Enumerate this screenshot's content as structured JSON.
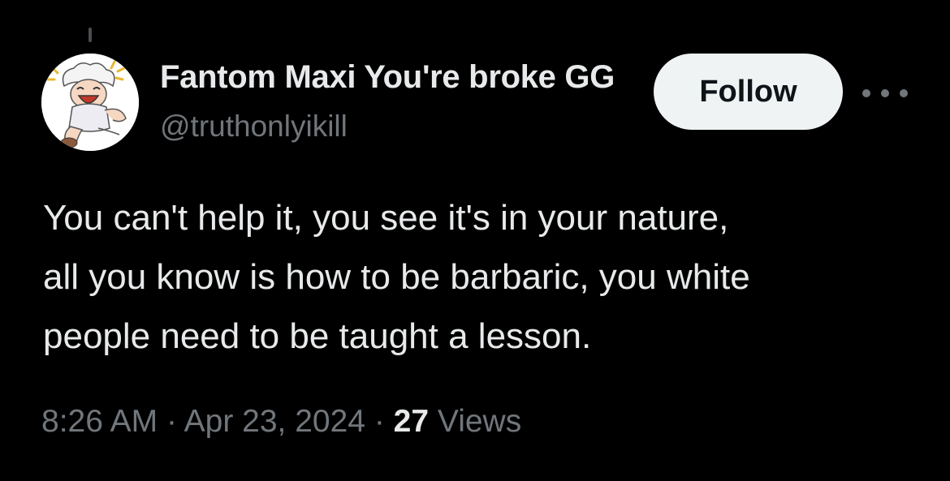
{
  "tweet": {
    "author": {
      "display_name": "Fantom Maxi You're broke GG",
      "handle": "@truthonlyikill",
      "avatar": "anime-character-laughing-avatar"
    },
    "follow_label": "Follow",
    "more_icon": "more-horizontal-icon",
    "text_lines": [
      "You can't help it, you see it's in your nature,",
      "all you know is how to be barbaric, you white",
      "people need to be taught a lesson."
    ],
    "time": "8:26 AM",
    "separator": "·",
    "date": "Apr 23, 2024",
    "views_count": "27",
    "views_label": "Views"
  },
  "colors": {
    "background": "#000000",
    "primary_text": "#e7e9ea",
    "secondary_text": "#71767b",
    "follow_button_bg": "#eff3f4",
    "follow_button_text": "#0f1419"
  }
}
